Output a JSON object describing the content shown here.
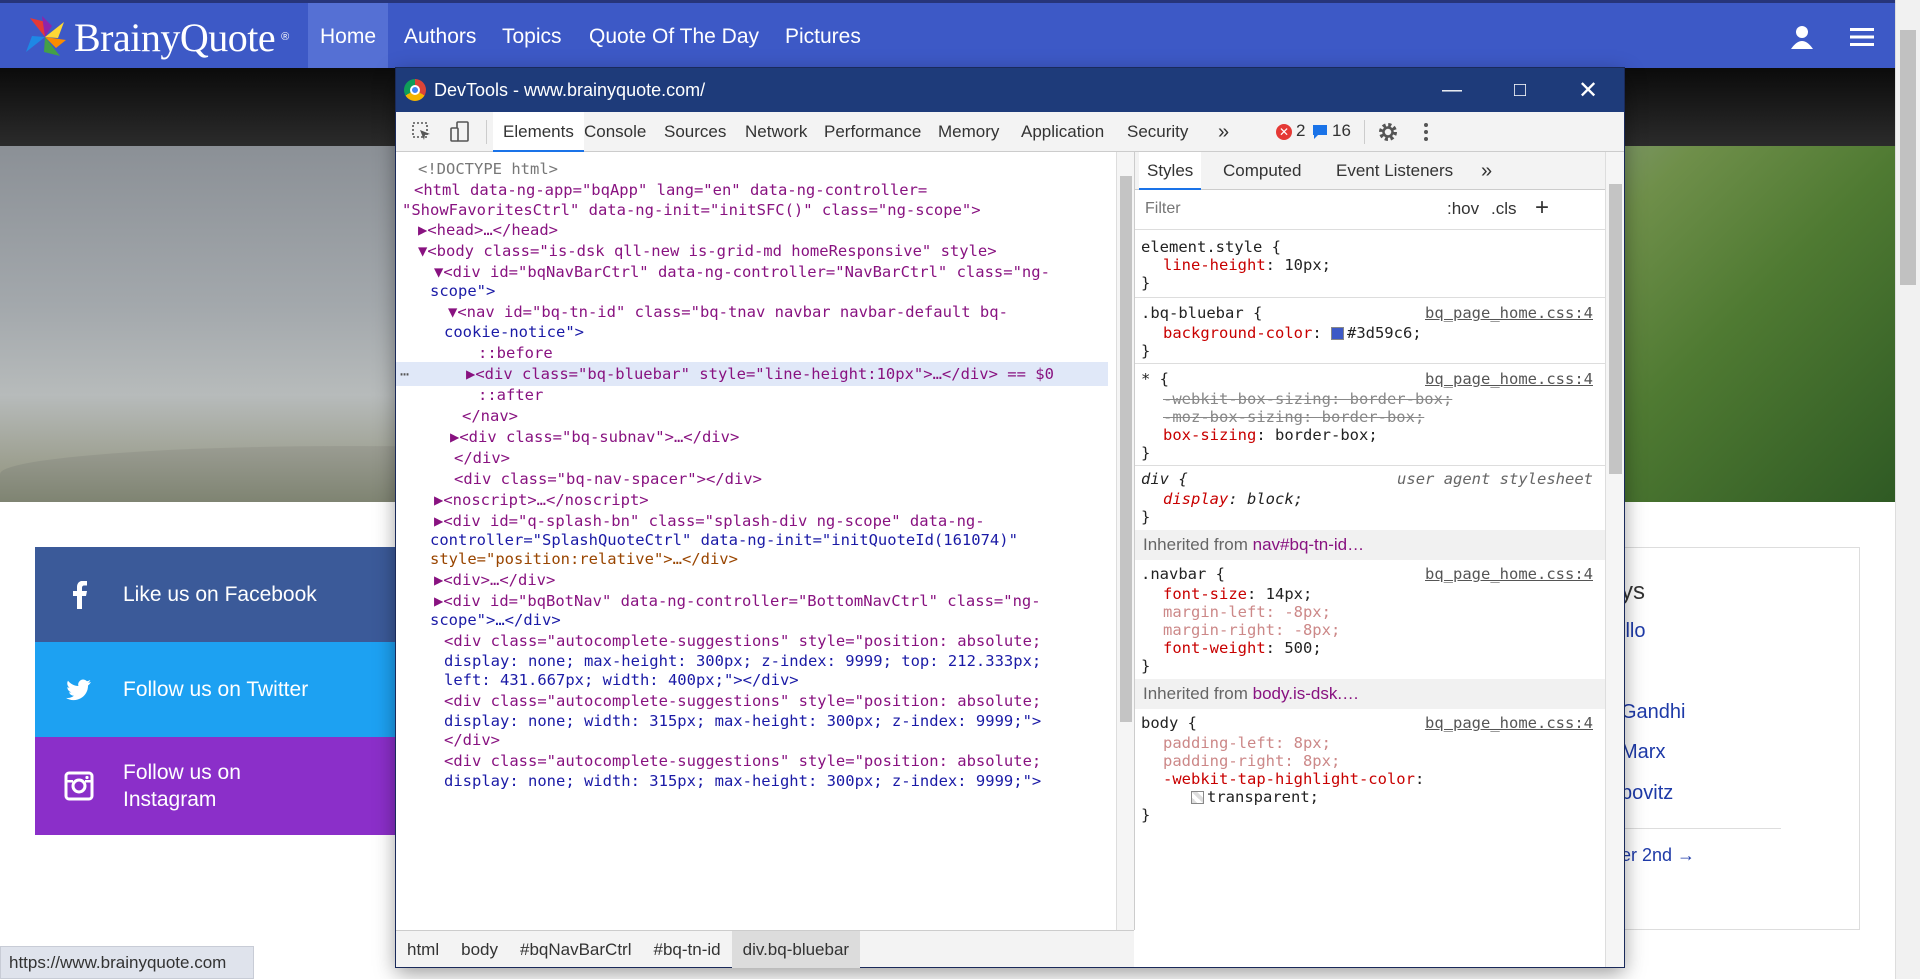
{
  "site": {
    "logo_text": "BrainyQuote",
    "logo_reg": "®",
    "nav": [
      "Home",
      "Authors",
      "Topics",
      "Quote Of The Day",
      "Pictures"
    ],
    "social": [
      {
        "label": "Like us on Facebook",
        "icon": "facebook-icon"
      },
      {
        "label": "Follow us on Twitter",
        "icon": "twitter-icon"
      },
      {
        "label": "Follow us on\nInstagram",
        "icon": "instagram-icon"
      }
    ],
    "card": [
      "ys",
      "illo",
      "Gandhi",
      "Marx",
      "bovitz",
      "er 2nd →"
    ],
    "status_url": "https://www.brainyquote.com"
  },
  "devtools": {
    "title": "DevTools - www.brainyquote.com/",
    "tabs": [
      "Elements",
      "Console",
      "Sources",
      "Network",
      "Performance",
      "Memory",
      "Application",
      "Security"
    ],
    "more": "»",
    "errors": "2",
    "messages": "16",
    "styles_tabs": [
      "Styles",
      "Computed",
      "Event Listeners"
    ],
    "filter_placeholder": "Filter",
    "hov": ":hov",
    "cls": ".cls",
    "breadcrumbs": [
      "html",
      "body",
      "#bqNavBarCtrl",
      "#bq-tn-id",
      "div.bq-bluebar"
    ],
    "dom_lines": [
      "<!DOCTYPE html>",
      "<html data-ng-app=\"bqApp\" lang=\"en\" data-ng-controller=",
      "\"ShowFavoritesCtrl\" data-ng-init=\"initSFC()\" class=\"ng-scope\">",
      "▶<head>…</head>",
      "▼<body class=\"is-dsk qll-new is-grid-md homeResponsive\" style>",
      "▼<div id=\"bqNavBarCtrl\" data-ng-controller=\"NavBarCtrl\" class=\"ng-",
      "scope\">",
      "▼<nav id=\"bq-tn-id\" class=\"bq-tnav navbar navbar-default bq-",
      "cookie-notice\">",
      "::before",
      "▶<div class=\"bq-bluebar\" style=\"line-height:10px\">…</div> == $0",
      "::after",
      "</nav>",
      "▶<div class=\"bq-subnav\">…</div>",
      "</div>",
      "<div class=\"bq-nav-spacer\"></div>",
      "▶<noscript>…</noscript>",
      "▶<div id=\"q-splash-bn\" class=\"splash-div ng-scope\" data-ng-",
      "controller=\"SplashQuoteCtrl\" data-ng-init=\"initQuoteId(161074)\"",
      "style=\"position:relative\">…</div>",
      "▶<div>…</div>",
      "▶<div id=\"bqBotNav\" data-ng-controller=\"BottomNavCtrl\" class=\"ng-",
      "scope\">…</div>",
      "<div class=\"autocomplete-suggestions\" style=\"position: absolute;",
      "display: none; max-height: 300px; z-index: 9999; top: 212.333px;",
      "left: 431.667px; width: 400px;\"></div>",
      "<div class=\"autocomplete-suggestions\" style=\"position: absolute;",
      "display: none; width: 315px; max-height: 300px; z-index: 9999;\">",
      "</div>",
      "<div class=\"autocomplete-suggestions\" style=\"position: absolute;",
      "display: none; width: 315px; max-height: 300px; z-index: 9999;\">"
    ],
    "styles": {
      "element_style_sel": "element.style {",
      "element_style_prop": "line-height",
      "element_style_val": "10px;",
      "bluebar_sel": ".bq-bluebar {",
      "bluebar_src": "bq_page_home.css:4",
      "bluebar_prop": "background-color",
      "bluebar_val": "#3d59c6;",
      "bluebar_color": "#3d59c6",
      "star_sel": "* {",
      "star_src": "bq_page_home.css:4",
      "star_p1": "-webkit-box-sizing: border-box;",
      "star_p2": "-moz-box-sizing: border-box;",
      "star_p3_prop": "box-sizing",
      "star_p3_val": "border-box;",
      "div_sel": "div {",
      "div_src": "user agent stylesheet",
      "div_prop": "display",
      "div_val": "block;",
      "inh1_label": "Inherited from",
      "inh1_ref": "nav#bq-tn-id…",
      "navbar_sel": ".navbar {",
      "navbar_src": "bq_page_home.css:4",
      "navbar_p1": "font-size",
      "navbar_v1": "14px;",
      "navbar_p2": "margin-left: -8px;",
      "navbar_p3": "margin-right: -8px;",
      "navbar_p4": "font-weight",
      "navbar_v4": "500;",
      "inh2_label": "Inherited from",
      "inh2_ref": "body.is-dsk.…",
      "body_sel": "body {",
      "body_src": "bq_page_home.css:4",
      "body_p1": "padding-left: 8px;",
      "body_p2": "padding-right: 8px;",
      "body_p3": "-webkit-tap-highlight-color",
      "body_v3": "transparent;",
      "close_brace": "}"
    }
  }
}
